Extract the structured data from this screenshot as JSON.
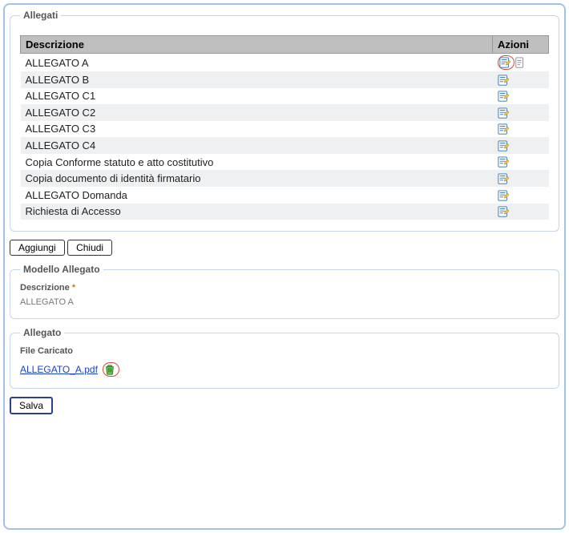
{
  "panel": {
    "title": "Allegati"
  },
  "table": {
    "headers": {
      "desc": "Descrizione",
      "actions": "Azioni"
    },
    "rows": [
      {
        "desc": "ALLEGATO A",
        "has_doc_icon": true,
        "highlight_edit": true
      },
      {
        "desc": "ALLEGATO B"
      },
      {
        "desc": "ALLEGATO C1"
      },
      {
        "desc": "ALLEGATO C2"
      },
      {
        "desc": "ALLEGATO C3"
      },
      {
        "desc": "ALLEGATO C4"
      },
      {
        "desc": "Copia Conforme statuto e atto costitutivo"
      },
      {
        "desc": "Copia documento di identità firmatario"
      },
      {
        "desc": "ALLEGATO Domanda"
      },
      {
        "desc": "Richiesta di Accesso"
      }
    ]
  },
  "buttons": {
    "add": "Aggiungi",
    "close": "Chiudi",
    "save": "Salva"
  },
  "model": {
    "title": "Modello Allegato",
    "desc_label": "Descrizione",
    "required_mark": "*",
    "desc_value": "ALLEGATO A"
  },
  "upload": {
    "title": "Allegato",
    "file_label": "File Caricato",
    "file_name": "ALLEGATO_A.pdf"
  }
}
